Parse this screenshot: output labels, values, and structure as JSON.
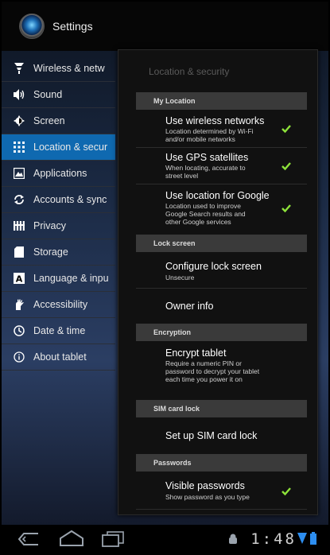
{
  "app": {
    "title": "Settings"
  },
  "sidebar": {
    "items": [
      {
        "label": "Wireless & netw",
        "icon": "wifi-icon"
      },
      {
        "label": "Sound",
        "icon": "speaker-icon"
      },
      {
        "label": "Screen",
        "icon": "brightness-icon"
      },
      {
        "label": "Location & secur",
        "icon": "grid-icon",
        "selected": true
      },
      {
        "label": "Applications",
        "icon": "applications-icon"
      },
      {
        "label": "Accounts & sync",
        "icon": "sync-icon"
      },
      {
        "label": "Privacy",
        "icon": "privacy-icon"
      },
      {
        "label": "Storage",
        "icon": "storage-icon"
      },
      {
        "label": "Language & inpu",
        "icon": "language-icon"
      },
      {
        "label": "Accessibility",
        "icon": "accessibility-icon"
      },
      {
        "label": "Date & time",
        "icon": "clock-icon"
      },
      {
        "label": "About tablet",
        "icon": "info-icon"
      }
    ]
  },
  "pane": {
    "title": "Location & security",
    "sections": {
      "my_location": "My Location",
      "lock_screen": "Lock screen",
      "encryption": "Encryption",
      "sim_card_lock": "SIM card lock",
      "passwords": "Passwords"
    },
    "prefs": {
      "wireless": {
        "title": "Use wireless networks",
        "summary": "Location determined by Wi-Fi and/or mobile networks",
        "checked": true
      },
      "gps": {
        "title": "Use GPS satellites",
        "summary": "When locating, accurate to street level",
        "checked": true
      },
      "google": {
        "title": "Use location for Google",
        "summary": "Location used to improve Google Search results and other Google services",
        "checked": true
      },
      "configure_lock": {
        "title": "Configure lock screen",
        "summary": "Unsecure"
      },
      "owner_info": {
        "title": "Owner info"
      },
      "encrypt": {
        "title": "Encrypt tablet",
        "summary": "Require a numeric PIN or password to decrypt your tablet each time you power it on"
      },
      "sim_lock": {
        "title": "Set up SIM card lock"
      },
      "visible_passwords": {
        "title": "Visible passwords",
        "summary": "Show password as you type",
        "checked": true
      }
    }
  },
  "statusbar": {
    "time": "1:48"
  },
  "colors": {
    "accent": "#0f69b0",
    "check": "#8ee33a"
  }
}
